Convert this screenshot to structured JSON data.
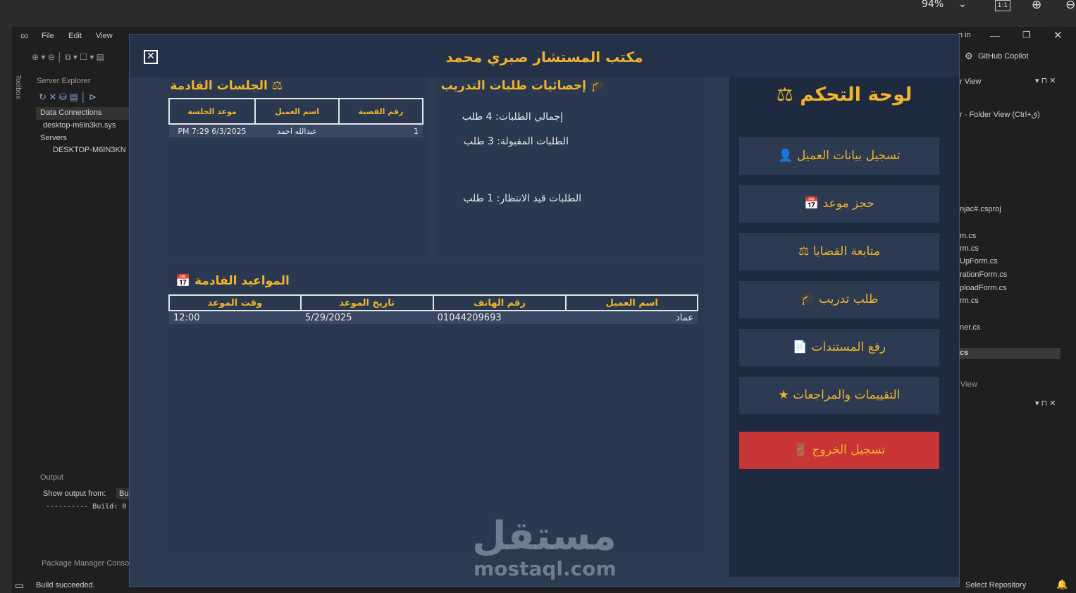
{
  "viewer": {
    "zoom": "94%",
    "fit_label": "1:1"
  },
  "vs": {
    "menu": [
      "File",
      "Edit",
      "View"
    ],
    "toolbox_label": "Toolbox",
    "server_explorer": {
      "title": "Server Explorer",
      "items": [
        "Data Connections",
        "desktop-m6in3kn.sys",
        "Servers",
        "DESKTOP-M6IN3KN"
      ]
    },
    "output": {
      "title": "Output",
      "show_from": "Show output from:",
      "source": "Bu",
      "line": "---------- Build: 0"
    },
    "package_manager": "Package Manager Conso",
    "status": "Build succeeded.",
    "github_copilot": "GitHub Copilot",
    "solution": {
      "view_label": "r View",
      "folder_view": "r - Folder View (Ctrl+ق)",
      "files": [
        "njac#.csproj",
        "m.cs",
        "rm.cs",
        "UpForm.cs",
        "rationForm.cs",
        "ploadForm.cs",
        "rm.cs",
        "ner.cs",
        "cs"
      ],
      "view2": "View"
    },
    "select_repo": "Select Repository",
    "sign_in": "n in"
  },
  "dialog": {
    "title": "مكتب المستشار صبري محمد",
    "sessions": {
      "title": "الجلسات القادمة",
      "headers": [
        "رقم القضية",
        "اسم العميل",
        "موعد الجلسة"
      ],
      "rows": [
        [
          "1",
          "عبدالله احمد",
          "PM 7:29 6/3/2025"
        ]
      ]
    },
    "training": {
      "title": "إحصائيات طلبات التدريب",
      "total": "إجمالي الطلبات: 4 طلب",
      "accepted": "الطلبات المقبولة: 3 طلب",
      "pending": "الطلبات قيد الانتظار: 1 طلب"
    },
    "appointments": {
      "title": "المواعيد القادمة",
      "headers": [
        "اسم العميل",
        "رقم الهاتف",
        "تاريخ الموعد",
        "وقت الموعد"
      ],
      "rows": [
        [
          "عماد",
          "01044209693",
          "5/29/2025",
          "12:00"
        ]
      ]
    },
    "sidebar": {
      "title": "لوحة التحكم",
      "items": [
        {
          "label": "تسجيل بيانات العميل",
          "icon": "user-icon"
        },
        {
          "label": "حجز موعد",
          "icon": "calendar-icon"
        },
        {
          "label": "متابعة القضايا",
          "icon": "scales-icon"
        },
        {
          "label": "طلب تدريب",
          "icon": "graduation-cap-icon"
        },
        {
          "label": "رفع المستندات",
          "icon": "document-icon"
        },
        {
          "label": "التقييمات والمراجعات",
          "icon": "star-icon"
        }
      ],
      "logout": "تسجيل الخروج"
    },
    "watermark": {
      "arabic": "مستقل",
      "latin": "mostaql.com"
    }
  },
  "colors": {
    "accent": "#f0b429",
    "dialog_bg": "#2c3a52",
    "sidebar_bg": "#1e2a40",
    "logout": "#c93535"
  }
}
